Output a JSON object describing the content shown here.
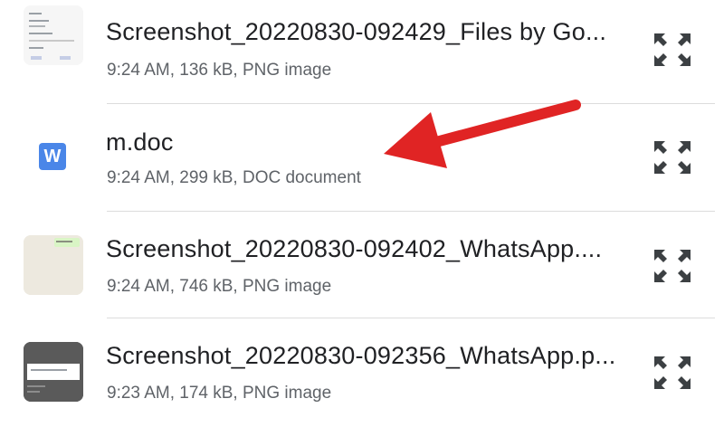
{
  "files": [
    {
      "name": "Screenshot_20220830-092429_Files by Go...",
      "meta": "9:24 AM, 136 kB, PNG image",
      "type": "image"
    },
    {
      "name": "m.doc",
      "meta": "9:24 AM, 299 kB, DOC document",
      "type": "doc",
      "badge": "W"
    },
    {
      "name": "Screenshot_20220830-092402_WhatsApp....",
      "meta": "9:24 AM, 746 kB, PNG image",
      "type": "image"
    },
    {
      "name": "Screenshot_20220830-092356_WhatsApp.p...",
      "meta": "9:23 AM, 174 kB, PNG image",
      "type": "image"
    }
  ],
  "icons": {
    "expand": "expand-icon",
    "document": "word-doc-icon"
  },
  "colors": {
    "arrow": "#e02424",
    "doc_badge": "#4a86e8"
  }
}
